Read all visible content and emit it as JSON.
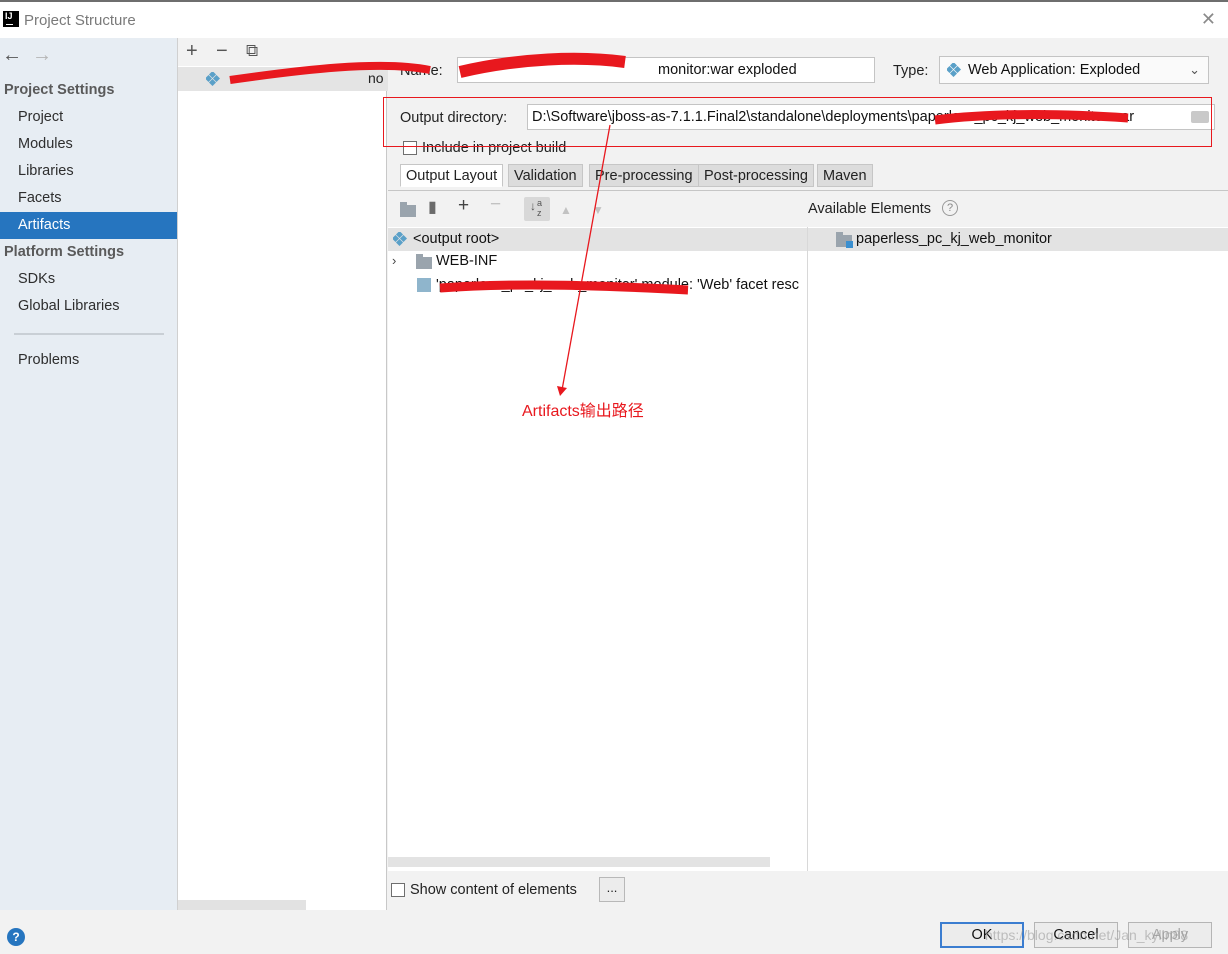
{
  "window": {
    "title": "Project Structure",
    "close_glyph": "✕"
  },
  "nav": {
    "back": "←",
    "forward": "→"
  },
  "sidebar": {
    "project_settings_header": "Project Settings",
    "project_items": [
      {
        "label": "Project"
      },
      {
        "label": "Modules"
      },
      {
        "label": "Libraries"
      },
      {
        "label": "Facets"
      },
      {
        "label": "Artifacts",
        "selected": true
      }
    ],
    "platform_settings_header": "Platform Settings",
    "platform_items": [
      {
        "label": "SDKs"
      },
      {
        "label": "Global Libraries"
      }
    ],
    "problems_label": "Problems"
  },
  "artifacts_list": {
    "toolbar": {
      "add": "+",
      "remove": "−",
      "copy": "⧉"
    },
    "items": [
      {
        "label": "no"
      }
    ]
  },
  "editor": {
    "name_label": "Name:",
    "name_value": "monitor:war exploded",
    "type_label": "Type:",
    "type_value": "Web Application: Exploded",
    "output_dir_label": "Output directory:",
    "output_dir_value": "D:\\Software\\jboss-as-7.1.1.Final2\\standalone\\deployments\\paperless_pc_kj_web_monitor.war",
    "include_in_build_label": "Include in project build",
    "include_in_build_checked": false,
    "tabs": [
      {
        "label": "Output Layout",
        "active": true
      },
      {
        "label": "Validation"
      },
      {
        "label": "Pre-processing"
      },
      {
        "label": "Post-processing"
      },
      {
        "label": "Maven"
      }
    ],
    "layout_tree": [
      {
        "label": "<output root>"
      },
      {
        "label": "WEB-INF"
      },
      {
        "label": "'paperless_pc_kj_web_monitor' module: 'Web' facet resc"
      }
    ],
    "available_title": "Available Elements",
    "available_items": [
      {
        "label": "paperless_pc_kj_web_monitor"
      }
    ],
    "show_content_label": "Show content of elements",
    "show_content_checked": false,
    "dots_label": "..."
  },
  "buttons": {
    "help": "?",
    "ok": "OK",
    "cancel": "Cancel",
    "apply": "Apply"
  },
  "watermark": "https://blog.csdn.net/Jan_kylin88",
  "annotation": {
    "label": "Artifacts输出路径",
    "color": "#e8181e"
  },
  "colors": {
    "selection_blue": "#2675bf",
    "sidebar_bg": "#e7edf3",
    "annotation_red": "#e8181e"
  },
  "icons": {
    "artifact": "web-artifact-icon",
    "folder": "folder-icon",
    "module": "module-icon",
    "sort": "sort-az-icon"
  }
}
